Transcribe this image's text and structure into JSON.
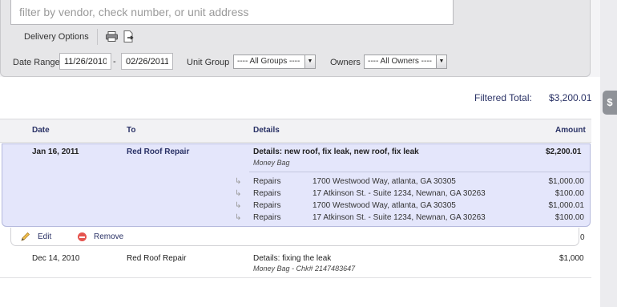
{
  "search": {
    "placeholder": "filter by vendor, check number, or unit address",
    "value": ""
  },
  "toolbar": {
    "delivery_options": "Delivery Options",
    "print_icon": "printer-icon",
    "export_icon": "export-icon"
  },
  "filters": {
    "date_range_label": "Date Range",
    "date_from": "11/26/2010",
    "date_separator": "-",
    "date_to": "02/26/2011",
    "unit_group_label": "Unit Group",
    "unit_group_value": "---- All Groups ----",
    "owners_label": "Owners",
    "owners_value": "---- All Owners ----"
  },
  "totals": {
    "label": "Filtered Total:",
    "value": "$3,200.01"
  },
  "side_tab": {
    "label": "$"
  },
  "table": {
    "headers": {
      "date": "Date",
      "to": "To",
      "details": "Details",
      "amount": "Amount"
    },
    "rows": [
      {
        "date": "Jan 16, 2011",
        "to": "Red Roof Repair",
        "details": "Details: new roof, fix leak, new roof, fix leak",
        "sub": "Money Bag",
        "amount": "$2,200.01",
        "splits": [
          {
            "arrow": "↳",
            "category": "Repairs",
            "address": "1700 Westwood Way, atlanta, GA 30305",
            "amount": "$1,000.00"
          },
          {
            "arrow": "↳",
            "category": "Repairs",
            "address": "17 Atkinson St. - Suite 1234, Newnan, GA 30263",
            "amount": "$100.00"
          },
          {
            "arrow": "↳",
            "category": "Repairs",
            "address": "1700 Westwood Way, atlanta, GA 30305",
            "amount": "$1,000.01"
          },
          {
            "arrow": "↳",
            "category": "Repairs",
            "address": "17 Atkinson St. - Suite 1234, Newnan, GA 30263",
            "amount": "$100.00"
          }
        ]
      },
      {
        "date": "Dec 14, 2010",
        "to": "Red Roof Repair",
        "details": "Details: fixing the leak",
        "sub": "Money Bag - Chk# 2147483647",
        "amount": "$1,000"
      }
    ],
    "actions": {
      "edit": "Edit",
      "remove": "Remove",
      "clipped_text": "0"
    }
  },
  "colors": {
    "selected_row": "#e4e6fb",
    "link": "#2a3266",
    "remove": "#e5544f"
  }
}
